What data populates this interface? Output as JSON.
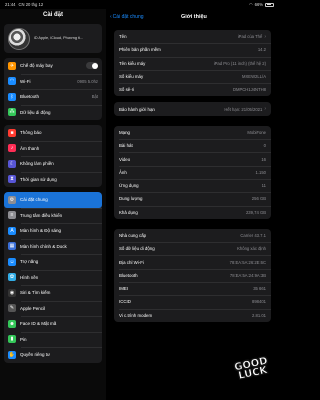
{
  "status": {
    "time": "21:44",
    "date": "CN 20 thg 12",
    "battery": "66%"
  },
  "sidebar": {
    "title": "Cài đặt",
    "profile_text": "iD Apple, iCloud, Phương ti...",
    "groups": [
      [
        {
          "label": "Chế độ máy bay",
          "icon": "airplane-icon",
          "color": "#ff9500",
          "glyph": "✈",
          "toggle": true
        },
        {
          "label": "Wi-Fi",
          "icon": "wifi-icon",
          "color": "#1a8cff",
          "glyph": "◠",
          "value": "0905 5.0hz"
        },
        {
          "label": "Bluetooth",
          "icon": "bluetooth-icon",
          "color": "#1a8cff",
          "glyph": "ᛒ",
          "value": "Bật"
        },
        {
          "label": "Dữ liệu di động",
          "icon": "cellular-icon",
          "color": "#34c759",
          "glyph": "⁂"
        }
      ],
      [
        {
          "label": "Thông báo",
          "icon": "notifications-icon",
          "color": "#ff3b30",
          "glyph": "■"
        },
        {
          "label": "Âm thanh",
          "icon": "sounds-icon",
          "color": "#ff2d55",
          "glyph": "♪"
        },
        {
          "label": "Không làm phiền",
          "icon": "moon-icon",
          "color": "#5856d6",
          "glyph": "☾"
        },
        {
          "label": "Thời gian sử dụng",
          "icon": "hourglass-icon",
          "color": "#5856d6",
          "glyph": "⧗"
        }
      ],
      [
        {
          "label": "Cài đặt chung",
          "icon": "gear-icon",
          "color": "#8e8e93",
          "glyph": "⚙",
          "active": true
        },
        {
          "label": "Trung tâm điều khiển",
          "icon": "control-center-icon",
          "color": "#8e8e93",
          "glyph": "≡"
        },
        {
          "label": "Màn hình & Độ sáng",
          "icon": "brightness-icon",
          "color": "#1a8cff",
          "glyph": "A"
        },
        {
          "label": "Màn hình chính & Dock",
          "icon": "home-screen-icon",
          "color": "#3a6fd8",
          "glyph": "▦"
        },
        {
          "label": "Trợ năng",
          "icon": "accessibility-icon",
          "color": "#1a8cff",
          "glyph": "☺"
        },
        {
          "label": "Hình nền",
          "icon": "wallpaper-icon",
          "color": "#32ade6",
          "glyph": "✿"
        },
        {
          "label": "Siri & Tìm kiếm",
          "icon": "siri-icon",
          "color": "#333333",
          "glyph": "◉"
        },
        {
          "label": "Apple Pencil",
          "icon": "pencil-icon",
          "color": "#555555",
          "glyph": "✎"
        },
        {
          "label": "Face ID & Mật mã",
          "icon": "faceid-icon",
          "color": "#34c759",
          "glyph": "☻"
        },
        {
          "label": "Pin",
          "icon": "battery-icon",
          "color": "#34c759",
          "glyph": "▮"
        },
        {
          "label": "Quyền riêng tư",
          "icon": "privacy-icon",
          "color": "#1a8cff",
          "glyph": "✋"
        }
      ]
    ]
  },
  "detail": {
    "back_label": "Cài đặt chung",
    "title": "Giới thiệu",
    "groups": [
      [
        {
          "label": "Tên",
          "value": "iPad của Thế",
          "chevron": true
        },
        {
          "label": "Phiên bản phần mềm",
          "value": "14.2"
        },
        {
          "label": "Tên kiểu máy",
          "value": "iPad Pro (11 inch) (thế hệ 2)"
        },
        {
          "label": "Số kiểu máy",
          "value": "MXEW2LL/A"
        },
        {
          "label": "Số sê-ri",
          "value": "DMPCH1J4NTH8"
        }
      ],
      [
        {
          "label": "Bảo hành giới hạn",
          "value": "Hết hạn: 21/05/2021",
          "chevron": true
        }
      ],
      [
        {
          "label": "Mạng",
          "value": "MobiFone"
        },
        {
          "label": "Bài hát",
          "value": "0"
        },
        {
          "label": "Video",
          "value": "16"
        },
        {
          "label": "Ảnh",
          "value": "1.150"
        },
        {
          "label": "Ứng dụng",
          "value": "11"
        },
        {
          "label": "Dung lượng",
          "value": "256 GB"
        },
        {
          "label": "Khả dụng",
          "value": "239,74 GB"
        }
      ],
      [
        {
          "label": "Nhà cung cấp",
          "value": "Carrier 43.7.1"
        },
        {
          "label": "Số dữ liệu di động",
          "value": "Không xác định"
        },
        {
          "label": "Địa chỉ Wi-Fi",
          "value": "78:EA:5A:26:2E:6C"
        },
        {
          "label": "Bluetooth",
          "value": "78:EA:5A:24:9A:3B"
        },
        {
          "label": "IMEI",
          "value": "35 661"
        },
        {
          "label": "ICCID",
          "value": "898401"
        },
        {
          "label": "Vi c.trình modem",
          "value": "2.81.01"
        }
      ]
    ]
  },
  "sticker": {
    "line1": "GOOD",
    "line2": "LUCK"
  }
}
